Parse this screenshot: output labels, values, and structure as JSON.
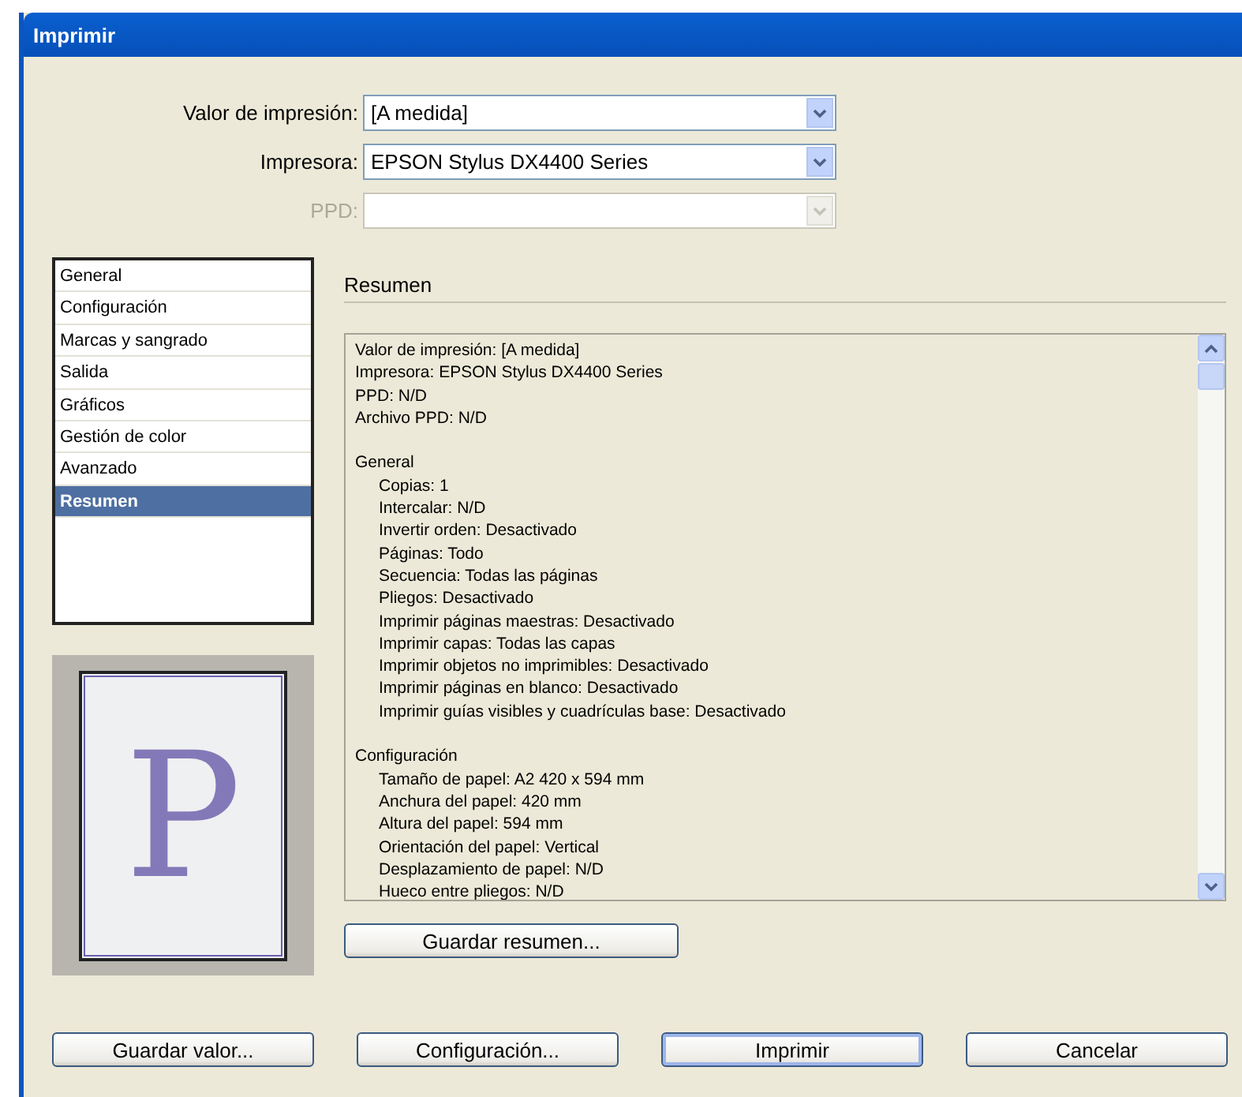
{
  "window": {
    "title": "Imprimir"
  },
  "fields": [
    {
      "label": "Valor de impresión:",
      "value": "[A medida]",
      "disabled": false
    },
    {
      "label": "Impresora:",
      "value": "EPSON Stylus DX4400 Series",
      "disabled": false
    },
    {
      "label": "PPD:",
      "disabled": true
    }
  ],
  "sidebar": {
    "items": [
      {
        "label": "General",
        "selected": false
      },
      {
        "label": "Configuración",
        "selected": false
      },
      {
        "label": "Marcas y sangrado",
        "selected": false
      },
      {
        "label": "Salida",
        "selected": false
      },
      {
        "label": "Gráficos",
        "selected": false
      },
      {
        "label": "Gestión de color",
        "selected": false
      },
      {
        "label": "Avanzado",
        "selected": false
      },
      {
        "label": "Resumen",
        "selected": true
      }
    ]
  },
  "preview": {
    "page_text": "P"
  },
  "summary": {
    "title": "Resumen",
    "sections": [
      {
        "lines": [
          "Valor de impresión: [A medida]",
          "Impresora: EPSON Stylus DX4400 Series",
          "PPD: N/D",
          "Archivo PPD: N/D"
        ]
      },
      {
        "heading": "General",
        "lines": [
          "Copias: 1",
          "Intercalar: N/D",
          "Invertir orden: Desactivado",
          "Páginas: Todo",
          "Secuencia: Todas las páginas",
          "Pliegos: Desactivado",
          "Imprimir páginas maestras: Desactivado",
          "Imprimir capas: Todas las capas",
          "Imprimir objetos no imprimibles: Desactivado",
          "Imprimir páginas en blanco: Desactivado",
          "Imprimir guías visibles y cuadrículas base: Desactivado"
        ]
      },
      {
        "heading": "Configuración",
        "lines": [
          "Tamaño de papel: A2 420 x 594 mm",
          "Anchura del papel: 420 mm",
          "Altura del papel: 594 mm",
          "Orientación del papel: Vertical",
          "Desplazamiento de papel: N/D",
          "Hueco entre pliegos: N/D"
        ]
      }
    ],
    "save_button": "Guardar resumen..."
  },
  "buttons": [
    {
      "label": "Guardar valor...",
      "default": false
    },
    {
      "label": "Configuración...",
      "default": false
    },
    {
      "label": "Imprimir",
      "default": true
    },
    {
      "label": "Cancelar",
      "default": false
    }
  ]
}
